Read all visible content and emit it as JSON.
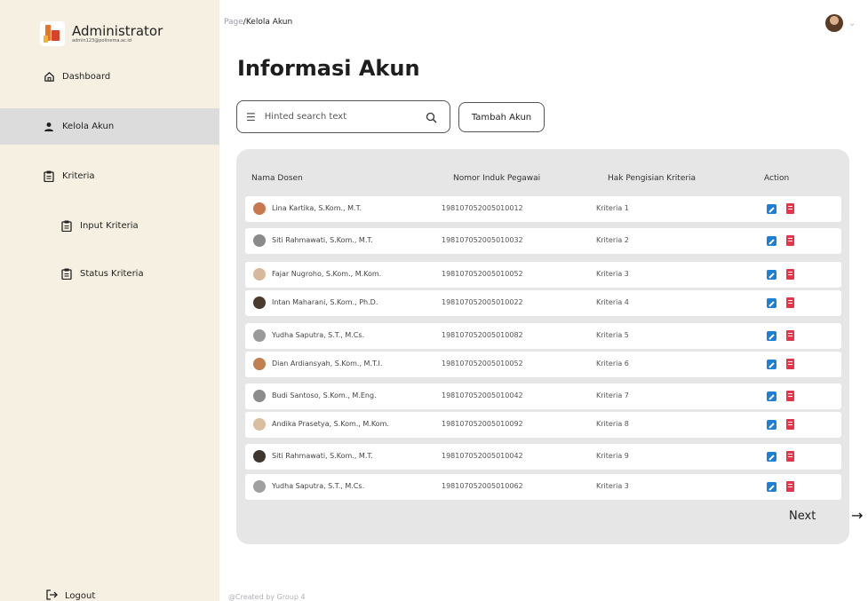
{
  "app": {
    "name": "Administrator",
    "email": "admin123@polinema.ac.id"
  },
  "sidebar": {
    "items": [
      {
        "label": "Dashboard",
        "icon": "home-icon"
      },
      {
        "label": "Kelola Akun",
        "icon": "user-icon",
        "active": true
      },
      {
        "label": "Kriteria",
        "icon": "clipboard-icon"
      },
      {
        "label": "Input Kriteria",
        "icon": "clipboard-icon"
      },
      {
        "label": "Status Kriteria",
        "icon": "clipboard-icon"
      }
    ],
    "logout": "Logout"
  },
  "breadcrumb": {
    "root": "Page",
    "separator": "/",
    "current": "Kelola Akun"
  },
  "main": {
    "title": "Informasi Akun",
    "search_placeholder": "Hinted search text",
    "add_button": "Tambah Akun"
  },
  "table": {
    "headers": [
      "Nama Dosen",
      "Nomor Induk Pegawai",
      "Hak Pengisian Kriteria",
      "Action"
    ],
    "rows": [
      {
        "name": "Lina Kartika, S.Kom., M.T.",
        "nip": "198107052005010012",
        "kriteria": "Kriteria 1"
      },
      {
        "name": "Siti Rahmawati, S.Kom., M.T.",
        "nip": "198107052005010032",
        "kriteria": "Kriteria 2"
      },
      {
        "name": "Fajar Nugroho, S.Kom., M.Kom.",
        "nip": "198107052005010052",
        "kriteria": "Kriteria 3"
      },
      {
        "name": "Intan Maharani, S.Kom., Ph.D.",
        "nip": "198107052005010022",
        "kriteria": "Kriteria 4"
      },
      {
        "name": "Yudha Saputra, S.T., M.Cs.",
        "nip": "198107052005010082",
        "kriteria": "Kriteria 5"
      },
      {
        "name": "Dian Ardiansyah, S.Kom., M.T.I.",
        "nip": "198107052005010052",
        "kriteria": "Kriteria 6"
      },
      {
        "name": "Budi Santoso, S.Kom., M.Eng.",
        "nip": "198107052005010042",
        "kriteria": "Kriteria 7"
      },
      {
        "name": "Andika Prasetya, S.Kom., M.Kom.",
        "nip": "198107052005010092",
        "kriteria": "Kriteria 8"
      },
      {
        "name": "Siti Rahmawati, S.Kom., M.T.",
        "nip": "198107052005010042",
        "kriteria": "Kriteria 9"
      },
      {
        "name": "Yudha Saputra, S.T., M.Cs.",
        "nip": "198107052005010062",
        "kriteria": "Kriteria 3"
      }
    ],
    "avatar_colors": [
      "#c9774f",
      "#8a8a8a",
      "#d8b89a",
      "#4a3a30",
      "#9a9a9a",
      "#c08050",
      "#8c8c8c",
      "#d9bfa0",
      "#3e3630",
      "#a0a0a0"
    ],
    "actions": {
      "edit_icon": "edit-icon",
      "delete_icon": "trash-icon"
    }
  },
  "pagination": {
    "next_label": "Next",
    "next_arrow": "→"
  },
  "footer": {
    "text": "@Created by Group 4"
  },
  "colors": {
    "sidebar_bg": "#f5f0e1",
    "active_item_bg": "#dcdcdc",
    "panel_bg": "#e6e6e6",
    "edit": "#1e7fd6",
    "delete": "#e8344a"
  }
}
